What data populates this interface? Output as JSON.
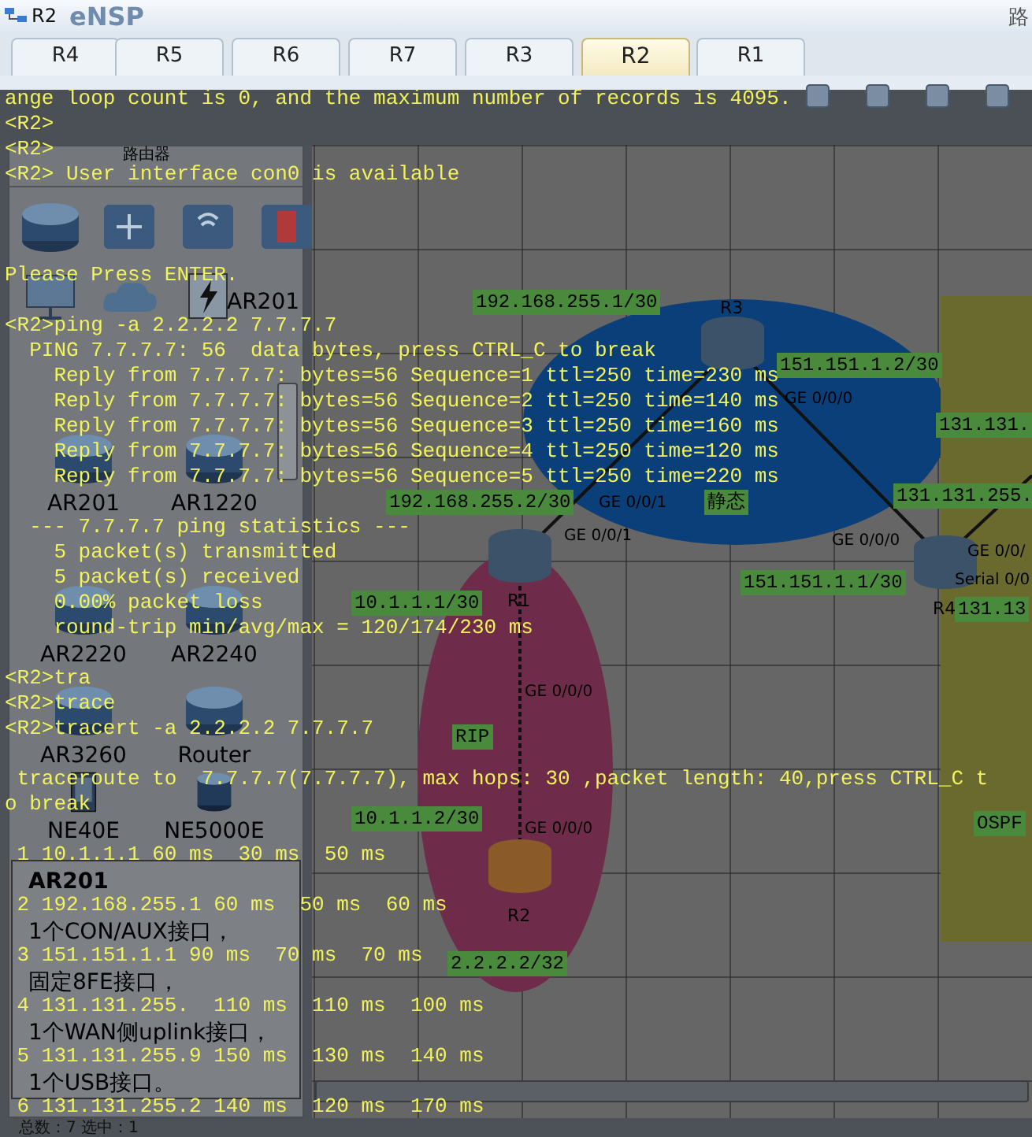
{
  "window": {
    "title": "R2",
    "app_name": "eNSP",
    "menu_hint": "路"
  },
  "tabs": [
    {
      "label": "R4",
      "selected": false
    },
    {
      "label": "R5",
      "selected": false
    },
    {
      "label": "R6",
      "selected": false
    },
    {
      "label": "R7",
      "selected": false
    },
    {
      "label": "R3",
      "selected": false
    },
    {
      "label": "R2",
      "selected": true
    },
    {
      "label": "R1",
      "selected": false
    }
  ],
  "device_panel": {
    "category": "路由器",
    "section_label": "AR201",
    "devices": [
      {
        "label": "AR201",
        "kind": "router"
      },
      {
        "label": "AR1220",
        "kind": "router"
      },
      {
        "label": "AR2220",
        "kind": "router"
      },
      {
        "label": "AR2240",
        "kind": "router"
      },
      {
        "label": "AR3260",
        "kind": "router"
      },
      {
        "label": "Router",
        "kind": "router"
      },
      {
        "label": "NE40E",
        "kind": "chassis"
      },
      {
        "label": "NE5000E",
        "kind": "core"
      }
    ],
    "tooltip": {
      "title": "AR201",
      "lines": [
        "1个CON/AUX接口，",
        "固定8FE接口，",
        "1个WAN侧uplink接口，",
        "1个USB接口。"
      ]
    }
  },
  "canvas": {
    "areas": [
      {
        "label": "静态",
        "kind": "ellipse",
        "color": "#0b3f7a"
      },
      {
        "label": "RIP",
        "kind": "ellipse",
        "color": "#6e2c4a"
      },
      {
        "label": "OSPF",
        "kind": "rect",
        "color": "#6b6a2e"
      }
    ],
    "nodes": [
      {
        "name": "R3",
        "color": "#3c5268"
      },
      {
        "name": "R1",
        "color": "#3c5268"
      },
      {
        "name": "R4",
        "color": "#3c5268"
      },
      {
        "name": "R2",
        "color": "#8a5a28"
      }
    ],
    "addresses": [
      "192.168.255.1/30",
      "151.151.1.2/30",
      "131.131.",
      "192.168.255.2/30",
      "131.131.255.",
      "10.1.1.1/30",
      "151.151.1.1/30",
      "131.13",
      "10.1.1.2/30",
      "2.2.2.2/32"
    ],
    "ports": [
      "GE 0/0/1",
      "GE 0/0/0",
      "GE 0/0/1",
      "GE 0/0/0",
      "GE 0/0/",
      "Serial 0/0",
      "GE 0/0/0",
      "GE 0/0/0"
    ]
  },
  "terminal": {
    "lines": [
      {
        "kind": "text",
        "text": "ange loop count is 0, and the maximum number of records is 4095."
      },
      {
        "kind": "text",
        "text": "<R2>"
      },
      {
        "kind": "text",
        "text": "<R2>"
      },
      {
        "kind": "text",
        "text": "<R2> User interface con0 is available"
      },
      {
        "kind": "blank"
      },
      {
        "kind": "blank"
      },
      {
        "kind": "blank"
      },
      {
        "kind": "text",
        "text": "Please Press ENTER."
      },
      {
        "kind": "blank"
      },
      {
        "kind": "text",
        "text": "<R2>ping -a 2.2.2.2 7.7.7.7"
      },
      {
        "kind": "text",
        "text": "  PING 7.7.7.7: 56  data bytes, press CTRL_C to break"
      },
      {
        "kind": "text",
        "text": "    Reply from 7.7.7.7: bytes=56 Sequence=1 ttl=250 time=230 ms"
      },
      {
        "kind": "text",
        "text": "    Reply from 7.7.7.7: bytes=56 Sequence=2 ttl=250 time=140 ms"
      },
      {
        "kind": "text",
        "text": "    Reply from 7.7.7.7: bytes=56 Sequence=3 ttl=250 time=160 ms"
      },
      {
        "kind": "text",
        "text": "    Reply from 7.7.7.7: bytes=56 Sequence=4 ttl=250 time=120 ms"
      },
      {
        "kind": "text",
        "text": "    Reply from 7.7.7.7: bytes=56 Sequence=5 ttl=250 time=220 ms"
      },
      {
        "kind": "blank"
      },
      {
        "kind": "text",
        "text": "  --- 7.7.7.7 ping statistics ---"
      },
      {
        "kind": "text",
        "text": "    5 packet(s) transmitted"
      },
      {
        "kind": "text",
        "text": "    5 packet(s) received"
      },
      {
        "kind": "text",
        "text": "    0.00% packet loss"
      },
      {
        "kind": "text",
        "text": "    round-trip min/avg/max = 120/174/230 ms"
      },
      {
        "kind": "blank"
      },
      {
        "kind": "text",
        "text": "<R2>tra"
      },
      {
        "kind": "text",
        "text": "<R2>trace"
      },
      {
        "kind": "text",
        "text": "<R2>tracert -a 2.2.2.2 7.7.7.7"
      },
      {
        "kind": "blank"
      },
      {
        "kind": "text",
        "text": " traceroute to  7.7.7.7(7.7.7.7), max hops: 30 ,packet length: 40,press CTRL_C t"
      },
      {
        "kind": "text",
        "text": "o break"
      },
      {
        "kind": "blank"
      },
      {
        "kind": "text",
        "text": " 1 10.1.1.1 60 ms  30 ms  50 ms"
      },
      {
        "kind": "blank"
      },
      {
        "kind": "text",
        "text": " 2 192.168.255.1 60 ms  50 ms  60 ms"
      },
      {
        "kind": "blank"
      },
      {
        "kind": "text",
        "text": " 3 151.151.1.1 90 ms  70 ms  70 ms"
      },
      {
        "kind": "blank"
      },
      {
        "kind": "text",
        "text": " 4 131.131.255.  110 ms  110 ms  100 ms"
      },
      {
        "kind": "blank"
      },
      {
        "kind": "text",
        "text": " 5 131.131.255.9 150 ms  130 ms  140 ms"
      },
      {
        "kind": "blank"
      },
      {
        "kind": "text",
        "text": " 6 131.131.255.2 140 ms  120 ms  170 ms"
      }
    ]
  },
  "status_bar": "总数：7 选中：1"
}
